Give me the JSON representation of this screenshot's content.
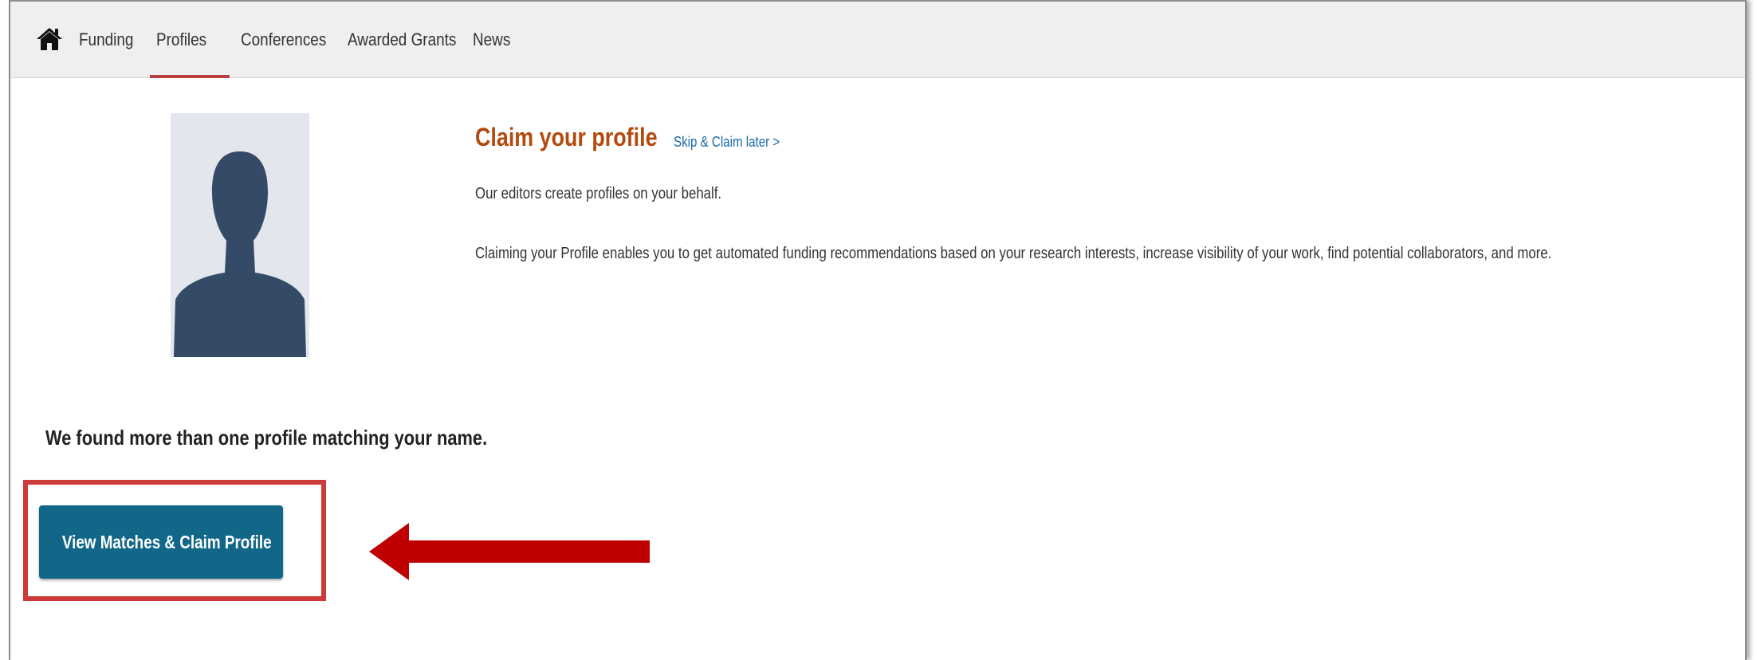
{
  "navbar": {
    "home_icon": "home-icon",
    "items": [
      {
        "label": "Funding"
      },
      {
        "label": "Profiles",
        "active": true
      },
      {
        "label": "Conferences"
      },
      {
        "label": "Awarded Grants"
      },
      {
        "label": "News"
      }
    ]
  },
  "profile": {
    "avatar_icon": "person-silhouette-icon",
    "title": "Claim your profile",
    "skip_link": "Skip & Claim later >",
    "line1": "Our editors create profiles on your behalf.",
    "line2": "Claiming your Profile enables you to get automated funding recommendations based on your research interests, increase visibility of your work, find potential collaborators, and more."
  },
  "matches": {
    "message": "We found more than one profile matching your name.",
    "button_label": "View Matches & Claim Profile"
  },
  "annotation": {
    "arrow_icon": "arrow-left-icon",
    "highlight_color": "#cc3a3a",
    "arrow_color": "#c00000"
  },
  "colors": {
    "accent_button": "#126789",
    "title": "#b3490d",
    "link": "#1a6aa5",
    "active_tab_underline": "#b84040"
  }
}
